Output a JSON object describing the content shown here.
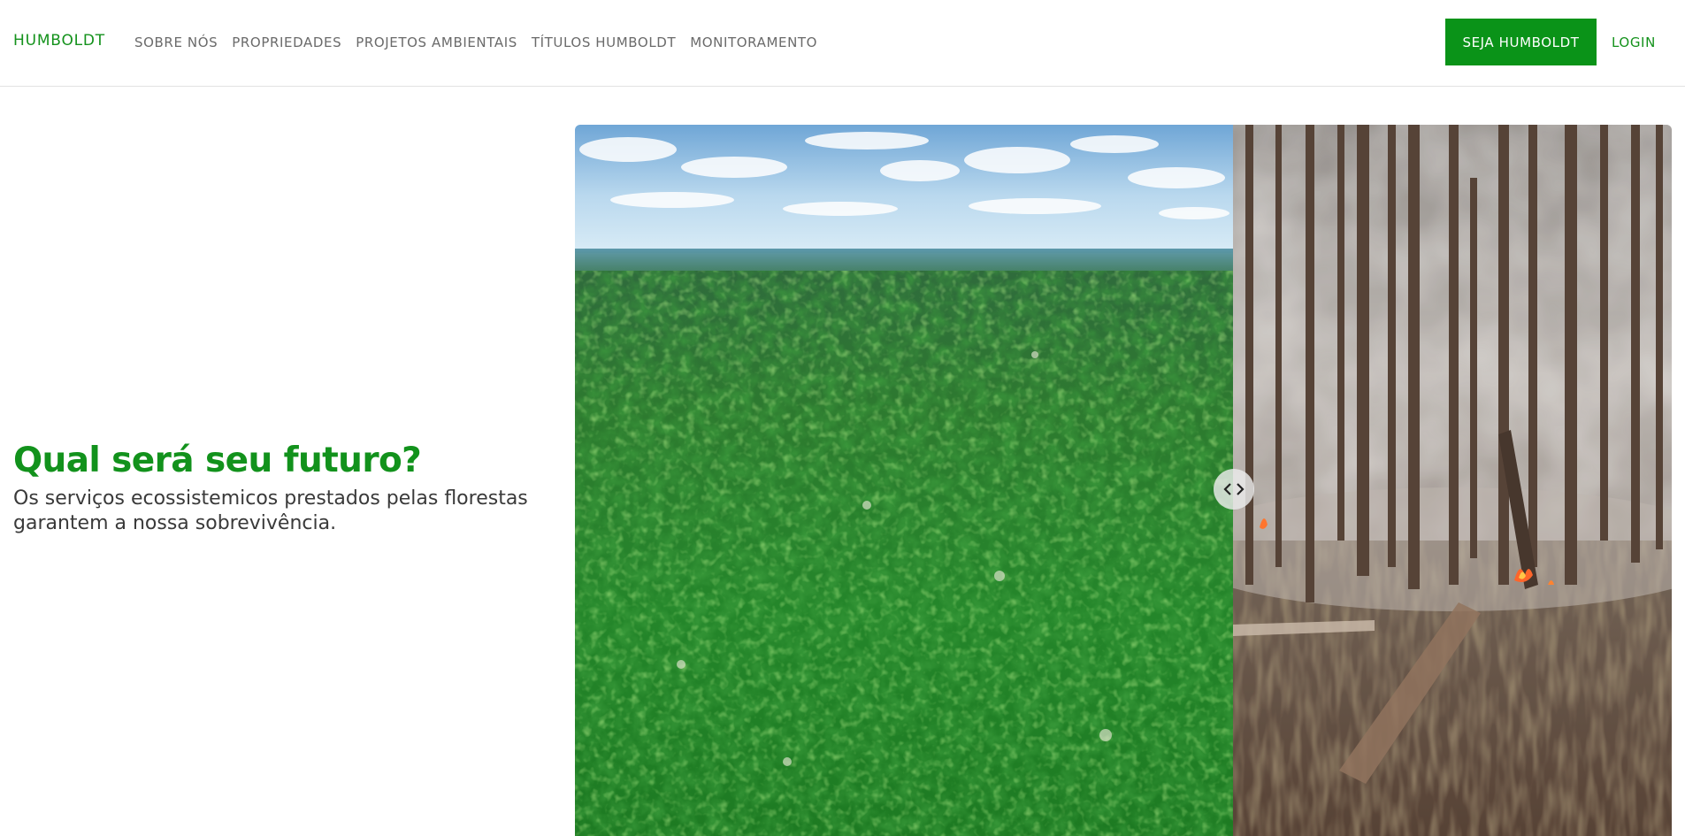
{
  "header": {
    "brand": "HUMBOLDT",
    "nav": [
      {
        "label": "SOBRE NÓS"
      },
      {
        "label": "PROPRIEDADES"
      },
      {
        "label": "PROJETOS AMBIENTAIS"
      },
      {
        "label": "TÍTULOS HUMBOLDT"
      },
      {
        "label": "MONITORAMENTO"
      }
    ],
    "cta_label": "SEJA HUMBOLDT",
    "login_label": "LOGIN"
  },
  "hero": {
    "title": "Qual será seu futuro?",
    "subtitle": "Os serviços ecossistemicos prestados pelas florestas garantem a nossa sobrevivência."
  },
  "comparison": {
    "left_image": "aerial-rainforest-photo",
    "right_image": "burning-forest-photo",
    "divider_position_fraction": 0.6,
    "handle_icons": [
      "chevron-left-icon",
      "chevron-right-icon"
    ]
  },
  "colors": {
    "brand_green": "#14921c",
    "cta_green": "#0a9318",
    "nav_text": "#6a6a6a",
    "body_text": "#3a3a3a"
  }
}
